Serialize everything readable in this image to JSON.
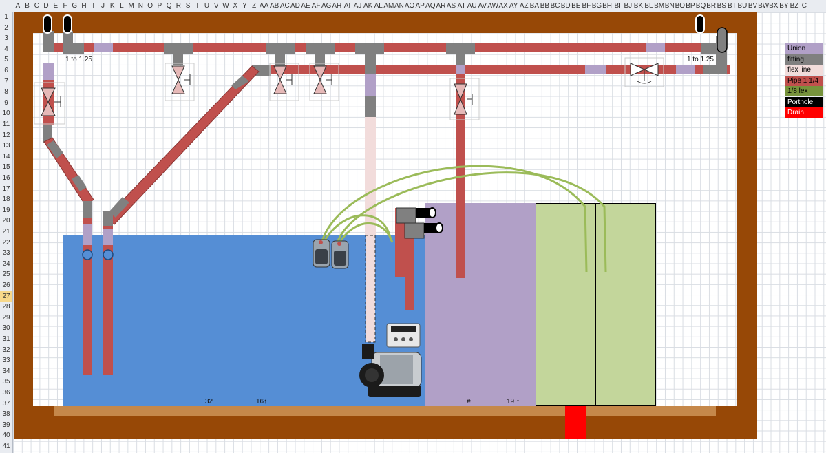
{
  "spreadsheet": {
    "columns": [
      "A",
      "B",
      "C",
      "D",
      "E",
      "F",
      "G",
      "H",
      "I",
      "J",
      "K",
      "L",
      "M",
      "N",
      "O",
      "P",
      "Q",
      "R",
      "S",
      "T",
      "U",
      "V",
      "W",
      "X",
      "Y",
      "Z",
      "AA",
      "AB",
      "AC",
      "AD",
      "AE",
      "AF",
      "AG",
      "AH",
      "AI",
      "AJ",
      "AK",
      "AL",
      "AM",
      "AN",
      "AO",
      "AP",
      "AQ",
      "AR",
      "AS",
      "AT",
      "AU",
      "AV",
      "AW",
      "AX",
      "AY",
      "AZ",
      "BA",
      "BB",
      "BC",
      "BD",
      "BE",
      "BF",
      "BG",
      "BH",
      "BI",
      "BJ",
      "BK",
      "BL",
      "BM",
      "BN",
      "BO",
      "BP",
      "BQ",
      "BR",
      "BS",
      "BT",
      "BU",
      "BV",
      "BW",
      "BX",
      "BY",
      "BZ",
      "C"
    ],
    "rows": [
      "1",
      "2",
      "3",
      "4",
      "5",
      "6",
      "7",
      "8",
      "9",
      "10",
      "11",
      "12",
      "13",
      "14",
      "15",
      "16",
      "17",
      "18",
      "19",
      "20",
      "21",
      "22",
      "23",
      "24",
      "25",
      "26",
      "27",
      "28",
      "29",
      "30",
      "31",
      "32",
      "33",
      "34",
      "35",
      "36",
      "37",
      "38",
      "39",
      "40",
      "41"
    ],
    "selected_row": "27"
  },
  "diagram": {
    "size_left_label": "1 to 1.25",
    "size_right_label": "1 to 1.25",
    "tank_bottom_left_number": "32",
    "tank_bottom_left_flow": "16↑",
    "sump_bottom_hash": "#",
    "sump_bottom_flow": "19 ↑"
  },
  "legend": [
    {
      "label": "Union",
      "color": "#b1a0c7"
    },
    {
      "label": "fitting",
      "color": "#808080"
    },
    {
      "label": "flex line",
      "color": "#f2dcdb"
    },
    {
      "label": "Pipe 1 1/4",
      "color": "#c0504d"
    },
    {
      "label": "1/8 lex",
      "color": "#77933c"
    },
    {
      "label": "Porthole",
      "color": "#000000"
    },
    {
      "label": "Drain",
      "color": "#ff0000"
    }
  ],
  "colors": {
    "cabinet": "#974806",
    "water": "#558ed5",
    "sump": "#b1a0c7",
    "refugium": "#c3d69b",
    "pipe": "#c0504d",
    "fitting": "#808080",
    "union": "#b1a0c7",
    "flex": "#f2dcdb",
    "line": "#9bbb59",
    "shelf": "#c5884a",
    "drain": "#ff0000"
  },
  "icons": [
    "gate-valve-icon",
    "ball-valve-icon",
    "powerhead-icon",
    "return-pump-icon",
    "pump-controller-icon"
  ]
}
